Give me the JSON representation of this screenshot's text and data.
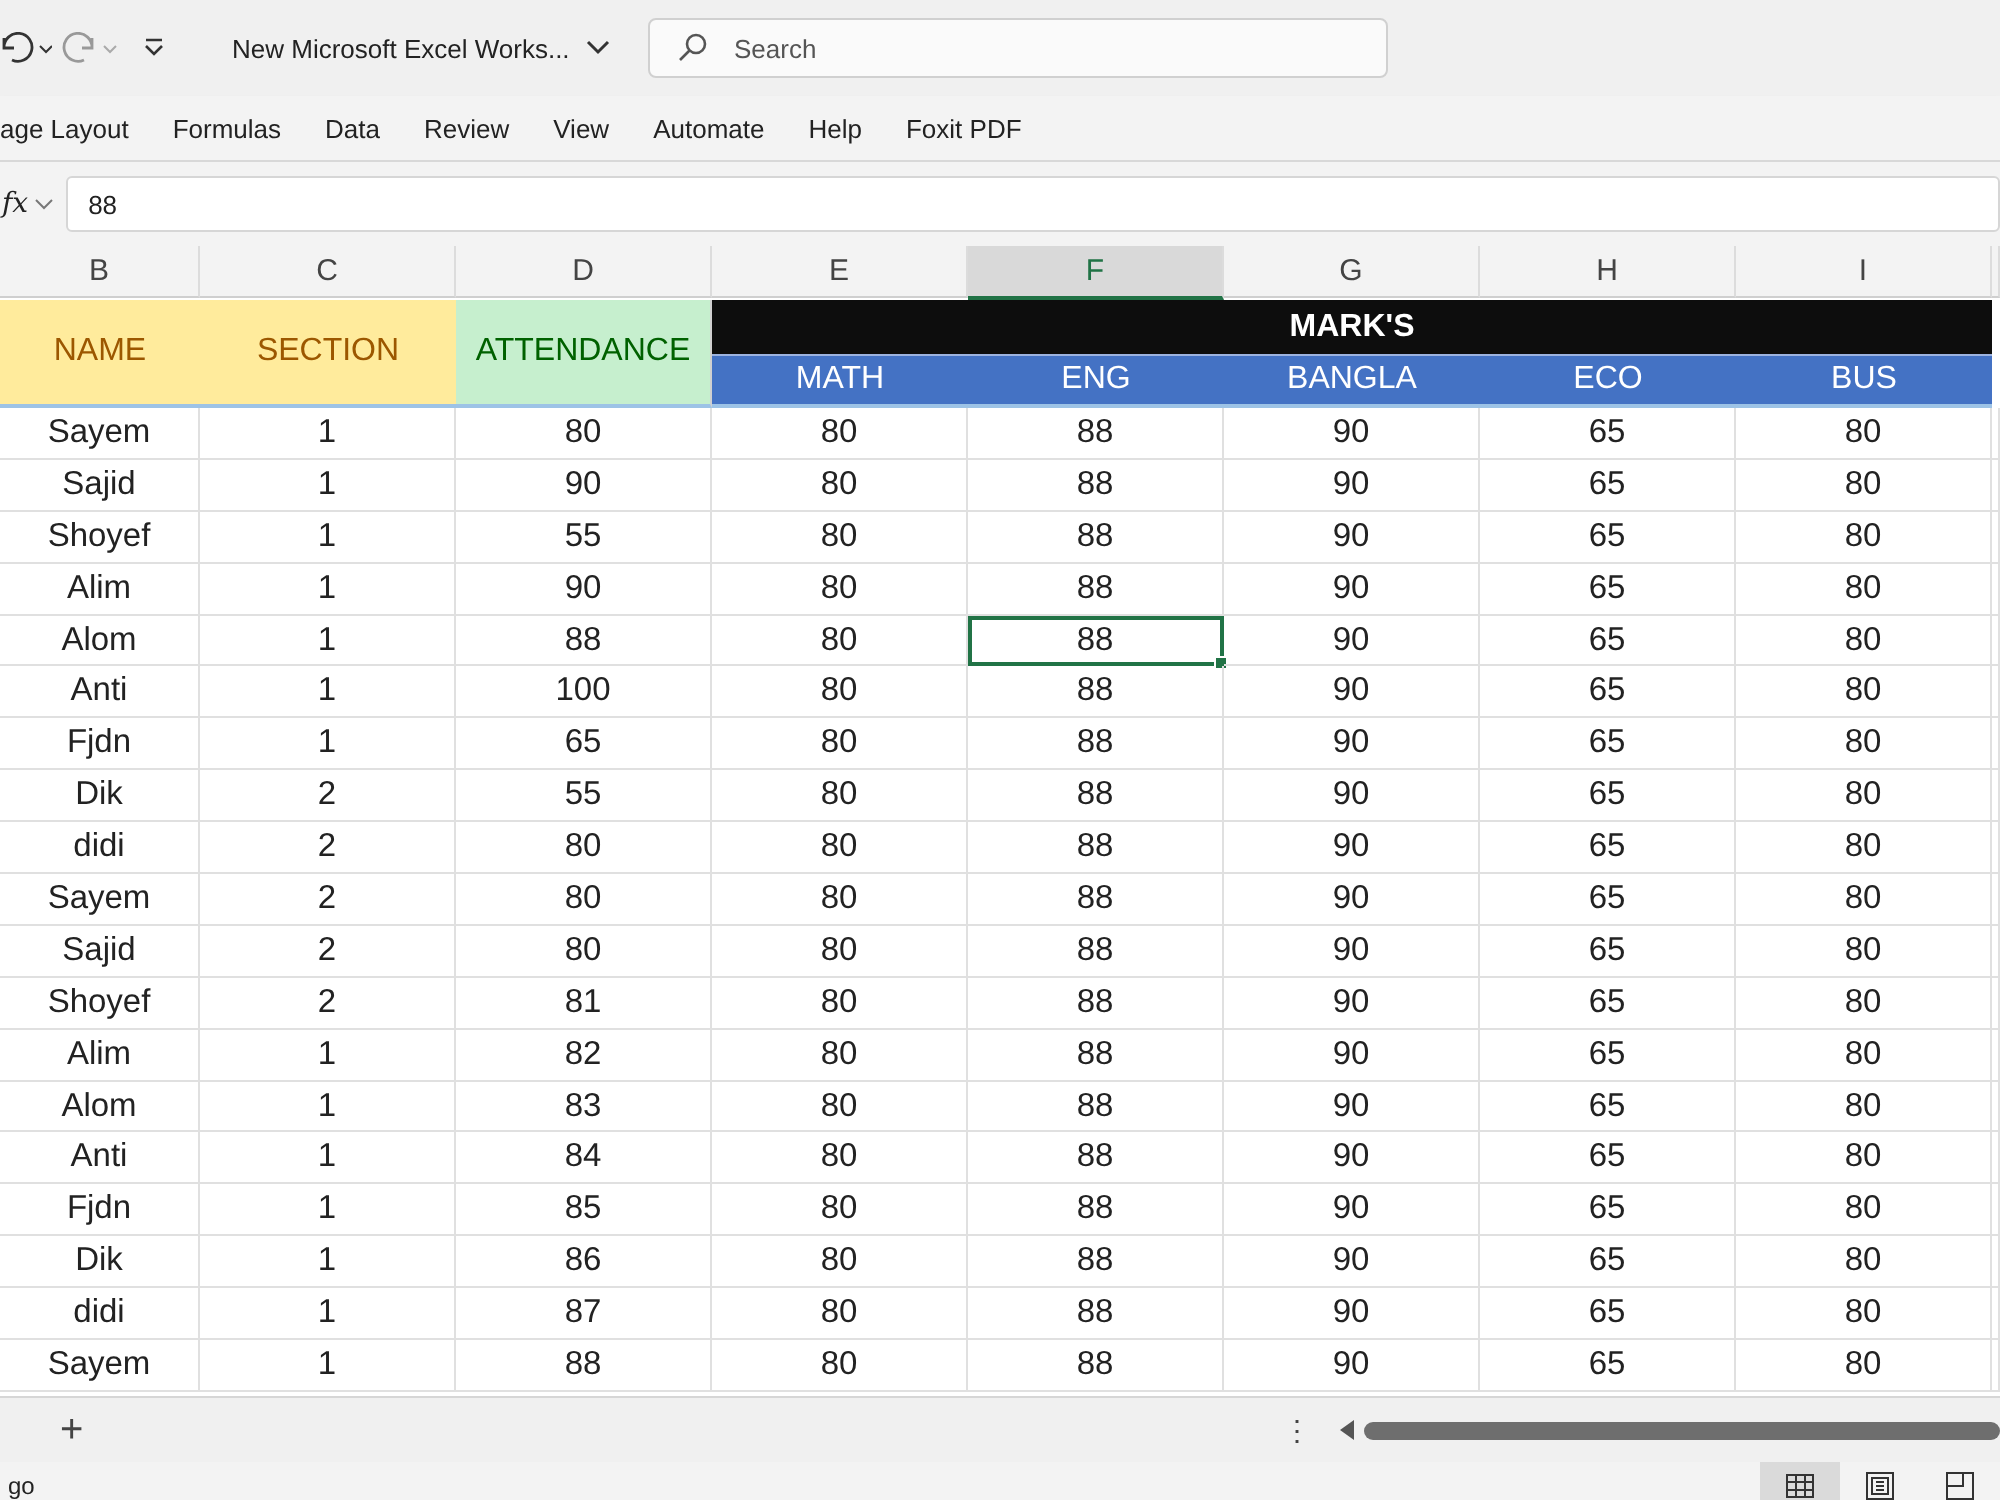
{
  "title_bar": {
    "file_name": "New Microsoft Excel Works...",
    "search": {
      "placeholder": "Search"
    }
  },
  "ribbon_tabs": [
    {
      "label": "age Layout"
    },
    {
      "label": "Formulas"
    },
    {
      "label": "Data"
    },
    {
      "label": "Review"
    },
    {
      "label": "View"
    },
    {
      "label": "Automate"
    },
    {
      "label": "Help"
    },
    {
      "label": "Foxit PDF"
    }
  ],
  "formula_bar": {
    "function_label": "fx",
    "value": "88"
  },
  "columns": [
    {
      "label": "B",
      "selected": false
    },
    {
      "label": "C",
      "selected": false
    },
    {
      "label": "D",
      "selected": false
    },
    {
      "label": "E",
      "selected": false
    },
    {
      "label": "F",
      "selected": true
    },
    {
      "label": "G",
      "selected": false
    },
    {
      "label": "H",
      "selected": false
    },
    {
      "label": "I",
      "selected": false
    }
  ],
  "header": {
    "name": "NAME",
    "section": "SECTION",
    "attendance": "ATTENDANCE",
    "group": "MARK'S",
    "subjects": [
      "MATH",
      "ENG",
      "BANGLA",
      "ECO",
      "BUS"
    ]
  },
  "rows": [
    {
      "selected": false,
      "cells": [
        "Sayem",
        "1",
        "80",
        "80",
        "88",
        "90",
        "65",
        "80"
      ]
    },
    {
      "selected": false,
      "cells": [
        "Sajid",
        "1",
        "90",
        "80",
        "88",
        "90",
        "65",
        "80"
      ]
    },
    {
      "selected": false,
      "cells": [
        "Shoyef",
        "1",
        "55",
        "80",
        "88",
        "90",
        "65",
        "80"
      ]
    },
    {
      "selected": false,
      "cells": [
        "Alim",
        "1",
        "90",
        "80",
        "88",
        "90",
        "65",
        "80"
      ]
    },
    {
      "selected": true,
      "cells": [
        "Alom",
        "1",
        "88",
        "80",
        "88",
        "90",
        "65",
        "80"
      ]
    },
    {
      "selected": false,
      "cells": [
        "Anti",
        "1",
        "100",
        "80",
        "88",
        "90",
        "65",
        "80"
      ]
    },
    {
      "selected": false,
      "cells": [
        "Fjdn",
        "1",
        "65",
        "80",
        "88",
        "90",
        "65",
        "80"
      ]
    },
    {
      "selected": false,
      "cells": [
        "Dik",
        "2",
        "55",
        "80",
        "88",
        "90",
        "65",
        "80"
      ]
    },
    {
      "selected": false,
      "cells": [
        "didi",
        "2",
        "80",
        "80",
        "88",
        "90",
        "65",
        "80"
      ]
    },
    {
      "selected": false,
      "cells": [
        "Sayem",
        "2",
        "80",
        "80",
        "88",
        "90",
        "65",
        "80"
      ]
    },
    {
      "selected": false,
      "cells": [
        "Sajid",
        "2",
        "80",
        "80",
        "88",
        "90",
        "65",
        "80"
      ]
    },
    {
      "selected": false,
      "cells": [
        "Shoyef",
        "2",
        "81",
        "80",
        "88",
        "90",
        "65",
        "80"
      ]
    },
    {
      "selected": false,
      "cells": [
        "Alim",
        "1",
        "82",
        "80",
        "88",
        "90",
        "65",
        "80"
      ]
    },
    {
      "selected": false,
      "cells": [
        "Alom",
        "1",
        "83",
        "80",
        "88",
        "90",
        "65",
        "80"
      ]
    },
    {
      "selected": false,
      "cells": [
        "Anti",
        "1",
        "84",
        "80",
        "88",
        "90",
        "65",
        "80"
      ]
    },
    {
      "selected": false,
      "cells": [
        "Fjdn",
        "1",
        "85",
        "80",
        "88",
        "90",
        "65",
        "80"
      ]
    },
    {
      "selected": false,
      "cells": [
        "Dik",
        "1",
        "86",
        "80",
        "88",
        "90",
        "65",
        "80"
      ]
    },
    {
      "selected": false,
      "cells": [
        "didi",
        "1",
        "87",
        "80",
        "88",
        "90",
        "65",
        "80"
      ]
    },
    {
      "selected": false,
      "cells": [
        "Sayem",
        "1",
        "88",
        "80",
        "88",
        "90",
        "65",
        "80"
      ]
    }
  ],
  "sheet_bar": {
    "add_label": "+",
    "menu_label": "⋮"
  },
  "status_bar": {
    "text": "go"
  },
  "view_buttons": [
    {
      "kind": "normal",
      "selected": true
    },
    {
      "kind": "page_layout",
      "selected": false
    },
    {
      "kind": "page_break",
      "selected": false
    }
  ]
}
